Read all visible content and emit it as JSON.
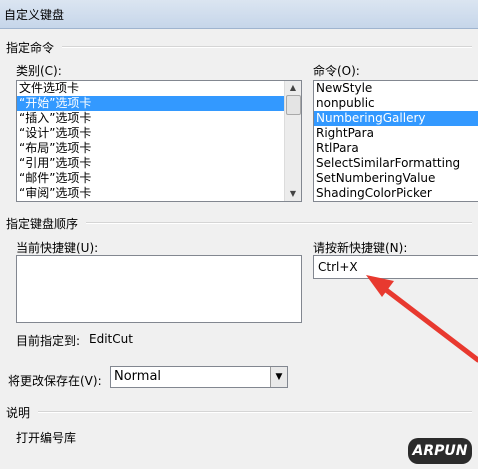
{
  "window": {
    "title": "自定义键盘"
  },
  "specify_command": {
    "section_title": "指定命令",
    "categories_label": "类别(C):",
    "categories": [
      "文件选项卡",
      "“开始”选项卡",
      "“插入”选项卡",
      "“设计”选项卡",
      "“布局”选项卡",
      "“引用”选项卡",
      "“邮件”选项卡",
      "“审阅”选项卡"
    ],
    "categories_selected_index": 1,
    "commands_label": "命令(O):",
    "commands": [
      "NewStyle",
      "nonpublic",
      "NumberingGallery",
      "RightPara",
      "RtlPara",
      "SelectSimilarFormatting",
      "SetNumberingValue",
      "ShadingColorPicker"
    ],
    "commands_selected_index": 2
  },
  "keyboard_sequence": {
    "section_title": "指定键盘顺序",
    "current_keys_label": "当前快捷键(U):",
    "new_key_label": "请按新快捷键(N):",
    "new_key_value": "Ctrl+X",
    "currently_assigned_label": "目前指定到:",
    "currently_assigned_value": "EditCut",
    "save_in_label": "将更改保存在(V):",
    "save_in_value": "Normal"
  },
  "description": {
    "section_title": "说明",
    "text": "打开编号库"
  },
  "watermark": {
    "text": "ARPUN"
  },
  "colors": {
    "selection": "#3399ff",
    "arrow": "#e8392f"
  }
}
